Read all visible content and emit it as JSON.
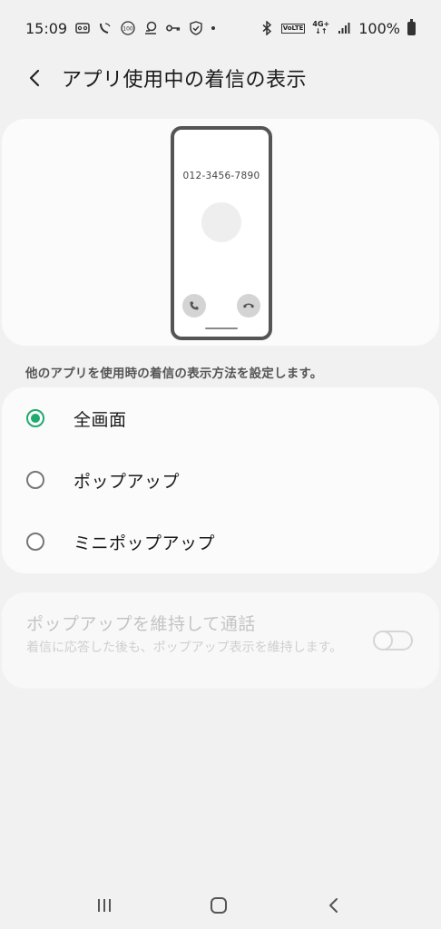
{
  "status_bar": {
    "time": "15:09",
    "network_small_top": "4G+",
    "volte": "VoLTE",
    "battery_text": "100%"
  },
  "app_bar": {
    "title": "アプリ使用中の着信の表示",
    "back_icon": "chevron-left-icon"
  },
  "preview": {
    "phone_number": "012-3456-7890"
  },
  "description": "他のアプリを使用時の着信の表示方法を設定します。",
  "options": [
    {
      "label": "全画面",
      "selected": true
    },
    {
      "label": "ポップアップ",
      "selected": false
    },
    {
      "label": "ミニポップアップ",
      "selected": false
    }
  ],
  "keep_popup": {
    "title": "ポップアップを維持して通話",
    "subtitle": "着信に応答した後も、ポップアップ表示を維持します。",
    "enabled": false
  },
  "colors": {
    "accent": "#1faa6e",
    "background": "#f1f1f1",
    "card": "#fbfbfb"
  }
}
